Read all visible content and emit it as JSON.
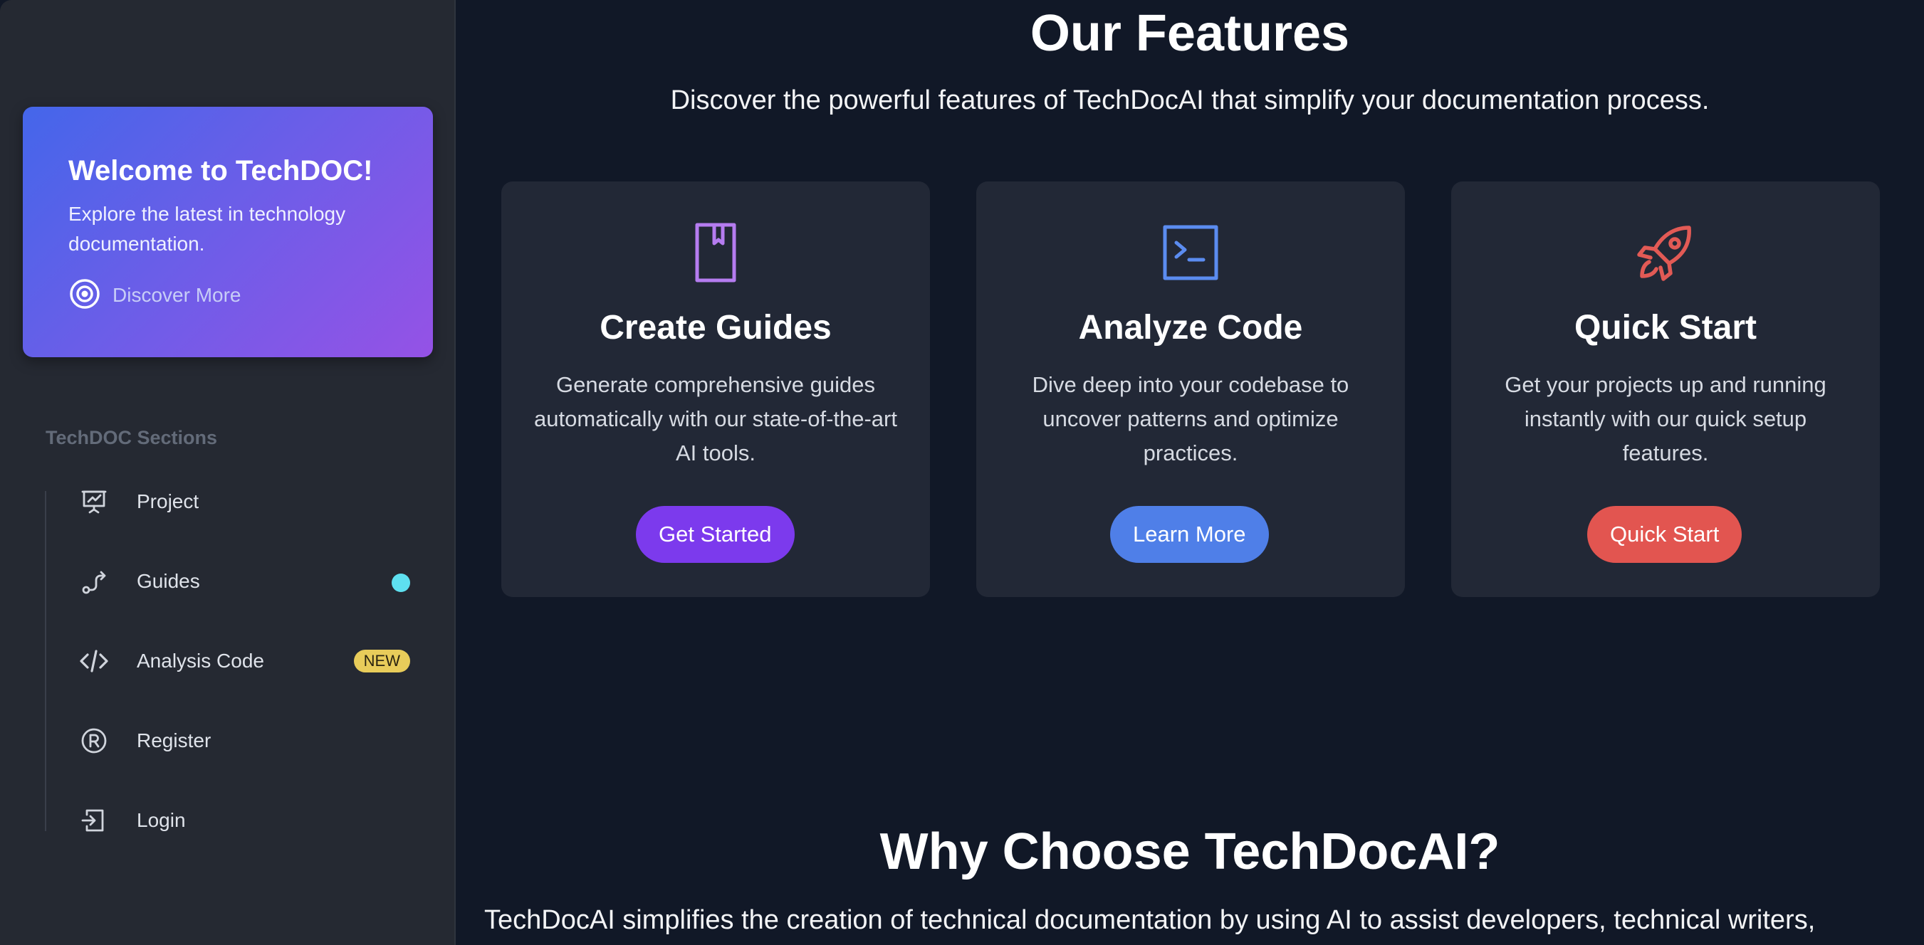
{
  "sidebar": {
    "welcome": {
      "title": "Welcome to TechDOC!",
      "description": "Explore the latest in technology documentation.",
      "link_label": "Discover More"
    },
    "sections_title": "TechDOC Sections",
    "items": [
      {
        "label": "Project",
        "icon": "presentation-chart-icon"
      },
      {
        "label": "Guides",
        "icon": "route-icon",
        "indicator": "dot"
      },
      {
        "label": "Analysis Code",
        "icon": "code-icon",
        "badge": "NEW"
      },
      {
        "label": "Register",
        "icon": "registered-icon"
      },
      {
        "label": "Login",
        "icon": "login-icon"
      }
    ]
  },
  "features": {
    "title": "Our Features",
    "subtitle": "Discover the powerful features of TechDocAI that simplify your documentation process.",
    "cards": [
      {
        "icon": "book-icon",
        "title": "Create Guides",
        "description": "Generate comprehensive guides automatically with our state-of-the-art AI tools.",
        "button": "Get Started",
        "accent": "#7c3aed"
      },
      {
        "icon": "terminal-icon",
        "title": "Analyze Code",
        "description": "Dive deep into your codebase to uncover patterns and optimize practices.",
        "button": "Learn More",
        "accent": "#4f7fe8"
      },
      {
        "icon": "rocket-icon",
        "title": "Quick Start",
        "description": "Get your projects up and running instantly with our quick setup features.",
        "button": "Quick Start",
        "accent": "#e25550"
      }
    ]
  },
  "why": {
    "title": "Why Choose TechDocAI?",
    "text": "TechDocAI simplifies the creation of technical documentation by using AI to assist developers, technical writers,"
  },
  "colors": {
    "background": "#111827",
    "sidebar": "#252932",
    "card": "#222836",
    "indicator_dot": "#5ee0f0",
    "badge": "#e8cc5a"
  }
}
